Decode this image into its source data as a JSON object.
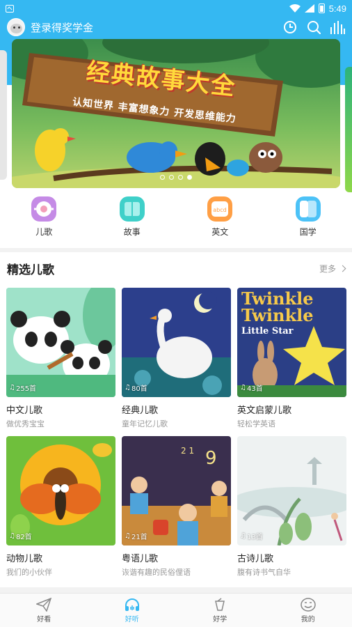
{
  "status_bar": {
    "time": "5:49"
  },
  "header": {
    "login_text": "登录得奖学金",
    "icons": [
      "clock-icon",
      "search-icon",
      "equalizer-icon"
    ]
  },
  "banner": {
    "title": "经典故事大全",
    "subtitle": "认知世界  丰富想象力  开发思维能力",
    "dot_count": 4,
    "active_dot": 3
  },
  "categories": [
    {
      "label": "儿歌",
      "icon": "nursery-rhyme-icon",
      "color": "#c58be6"
    },
    {
      "label": "故事",
      "icon": "story-book-icon",
      "color": "#3fd0c9"
    },
    {
      "label": "英文",
      "icon": "abcd-english-icon",
      "color": "#ff9f45"
    },
    {
      "label": "国学",
      "icon": "classics-book-icon",
      "color": "#4cc2f7"
    }
  ],
  "section": {
    "title": "精选儿歌",
    "more_label": "更多"
  },
  "cards": [
    {
      "title": "中文儿歌",
      "subtitle": "做优秀宝宝",
      "count": "255首"
    },
    {
      "title": "经典儿歌",
      "subtitle": "童年记忆儿歌",
      "count": "80首"
    },
    {
      "title": "英文启蒙儿歌",
      "subtitle": "轻松学英语",
      "count": "43首",
      "thumb_text": [
        "Twinkle",
        "Twinkle",
        "Little Star"
      ]
    },
    {
      "title": "动物儿歌",
      "subtitle": "我们的小伙伴",
      "count": "82首"
    },
    {
      "title": "粤语儿歌",
      "subtitle": "诙谐有趣的民俗俚语",
      "count": "21首"
    },
    {
      "title": "古诗儿歌",
      "subtitle": "腹有诗书气自华",
      "count": "13首"
    }
  ],
  "bottom_nav": [
    {
      "label": "好看",
      "icon": "paper-plane-icon",
      "active": false
    },
    {
      "label": "好听",
      "icon": "headphones-icon",
      "active": true
    },
    {
      "label": "好学",
      "icon": "cup-icon",
      "active": false
    },
    {
      "label": "我的",
      "icon": "smile-face-icon",
      "active": false
    }
  ],
  "colors": {
    "accent": "#35b8f2",
    "header_bg": "#35b8f2"
  }
}
